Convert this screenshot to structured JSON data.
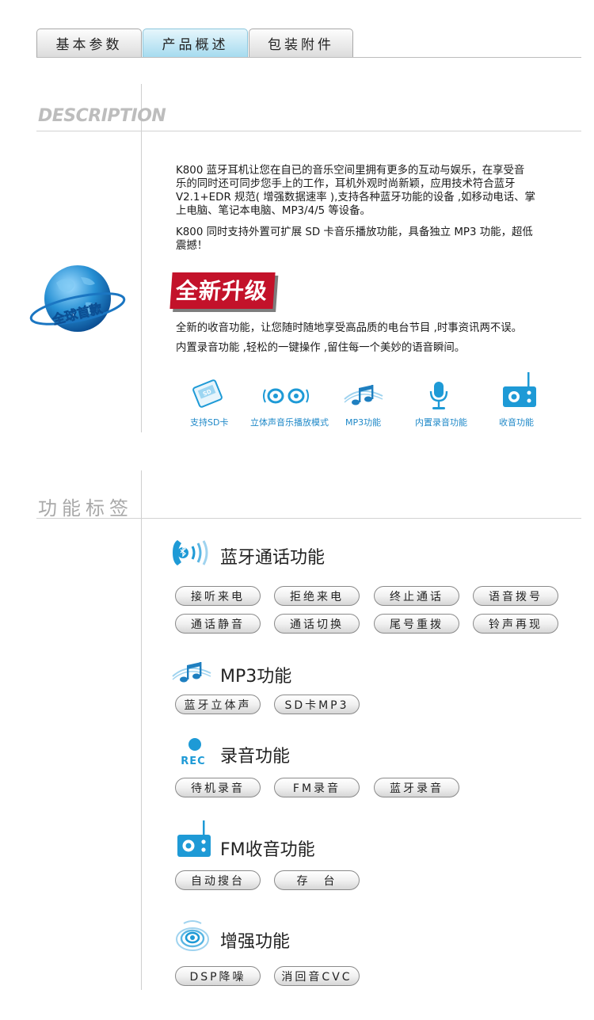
{
  "tabs": [
    {
      "label": "基本参数",
      "active": false
    },
    {
      "label": "产品概述",
      "active": true
    },
    {
      "label": "包装附件",
      "active": false
    }
  ],
  "description": {
    "heading": "DESCRIPTION",
    "paragraph1_lines": [
      "K800 蓝牙耳机让您在自已的音乐空间里拥有更多的互动与娱乐，在享受音",
      "乐的同时还可同步您手上的工作，耳机外观时尚新颖，应用技术符合蓝牙",
      "V2.1+EDR 规范( 增强数据速率 ),支持各种蓝牙功能的设备 ,如移动电话、掌",
      "上电脑、笔记本电脑、MP3/4/5 等设备。"
    ],
    "paragraph2_lines": [
      "K800 同时支持外置可扩展 SD 卡音乐播放功能，具备独立 MP3 功能，超低",
      "震撼！"
    ],
    "globe_badge": "全球首款",
    "upgrade_title": "全新升级",
    "upgrade_lines": [
      "全新的收音功能，让您随时随地享受高品质的电台节目 ,时事资讯两不误。",
      "内置录音功能 ,轻松的一键操作 ,留住每一个美妙的语音瞬间。"
    ],
    "features": [
      {
        "icon": "sd-card-icon",
        "label": "支持SD卡"
      },
      {
        "icon": "stereo-speakers-icon",
        "label": "立体声音乐播放模式"
      },
      {
        "icon": "music-notes-icon",
        "label": "MP3功能"
      },
      {
        "icon": "microphone-icon",
        "label": "内置录音功能"
      },
      {
        "icon": "radio-icon",
        "label": "收音功能"
      }
    ]
  },
  "function_tags": {
    "heading": "功能标签",
    "sections": [
      {
        "icon": "bluetooth-phone-icon",
        "title": "蓝牙通话功能",
        "tags": [
          "接听来电",
          "拒绝来电",
          "终止通话",
          "语音拨号",
          "通话静音",
          "通话切换",
          "尾号重拨",
          "铃声再现"
        ]
      },
      {
        "icon": "music-notes-icon",
        "title": "MP3功能",
        "tags": [
          "蓝牙立体声",
          "SD卡MP3"
        ]
      },
      {
        "icon": "rec-icon",
        "title": "录音功能",
        "icon_text": "REC",
        "tags": [
          "待机录音",
          "FM录音",
          "蓝牙录音"
        ]
      },
      {
        "icon": "radio-icon",
        "title": "FM收音功能",
        "tags": [
          "自动搜台",
          "存　台"
        ]
      },
      {
        "icon": "sound-wave-icon",
        "title": "增强功能",
        "tags": [
          "DSP降噪",
          "消回音CVC"
        ]
      }
    ]
  },
  "colors": {
    "accent_blue": "#1e9ad6",
    "upgrade_red": "#c3122a",
    "tab_active": "#a6dbef"
  }
}
